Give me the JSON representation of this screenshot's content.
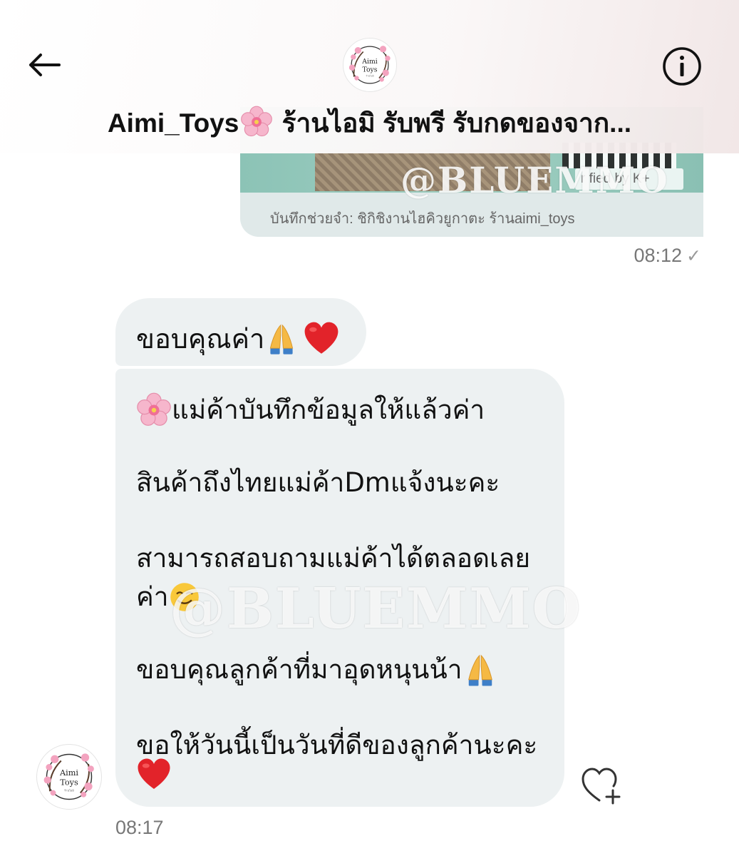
{
  "header": {
    "title": "Aimi_Toys🌸 ร้านไอมิ รับพรี รับกดของจาก...",
    "title_name": "Aimi_Toys",
    "title_rest": "ร้านไอมิ รับพรี รับกดของจาก...",
    "back_icon": "arrow-left-icon",
    "info_icon": "info-circle-icon",
    "avatar_logo_line1": "Aimi",
    "avatar_logo_line2": "Toys"
  },
  "messages": {
    "outgoing_card": {
      "stamp_text": "r fied by K+",
      "note": "บันทึกช่วยจำ: ชิกิชิงานไฮคิวยูกาตะ ร้านaimi_toys",
      "time": "08:12",
      "status_icon": "check-icon"
    },
    "incoming_1": {
      "text": "ขอบคุณค่า"
    },
    "incoming_2": {
      "line1": "แม่ค้าบันทึกข้อมูลให้แล้วค่า",
      "line2": "สินค้าถึงไทยแม่ค้าDmแจ้งนะคะ",
      "line3a": "สามารถสอบถามแม่ค้าได้ตลอดเลย",
      "line3b": "ค่า",
      "line4": "ขอบคุณลูกค้าที่มาอุดหนุนน้า",
      "line5": "ขอให้วันนี้เป็นวันที่ดีของลูกค้านะคะ",
      "time": "08:17"
    },
    "react_icon": "heart-plus-icon"
  },
  "watermark": {
    "text_top": "@BLUEMMO",
    "text_middle": "@BLUEMMO"
  },
  "colors": {
    "bubble_incoming": "#edf1f2",
    "card_background": "#e0e9e9",
    "timestamp": "#777777"
  }
}
